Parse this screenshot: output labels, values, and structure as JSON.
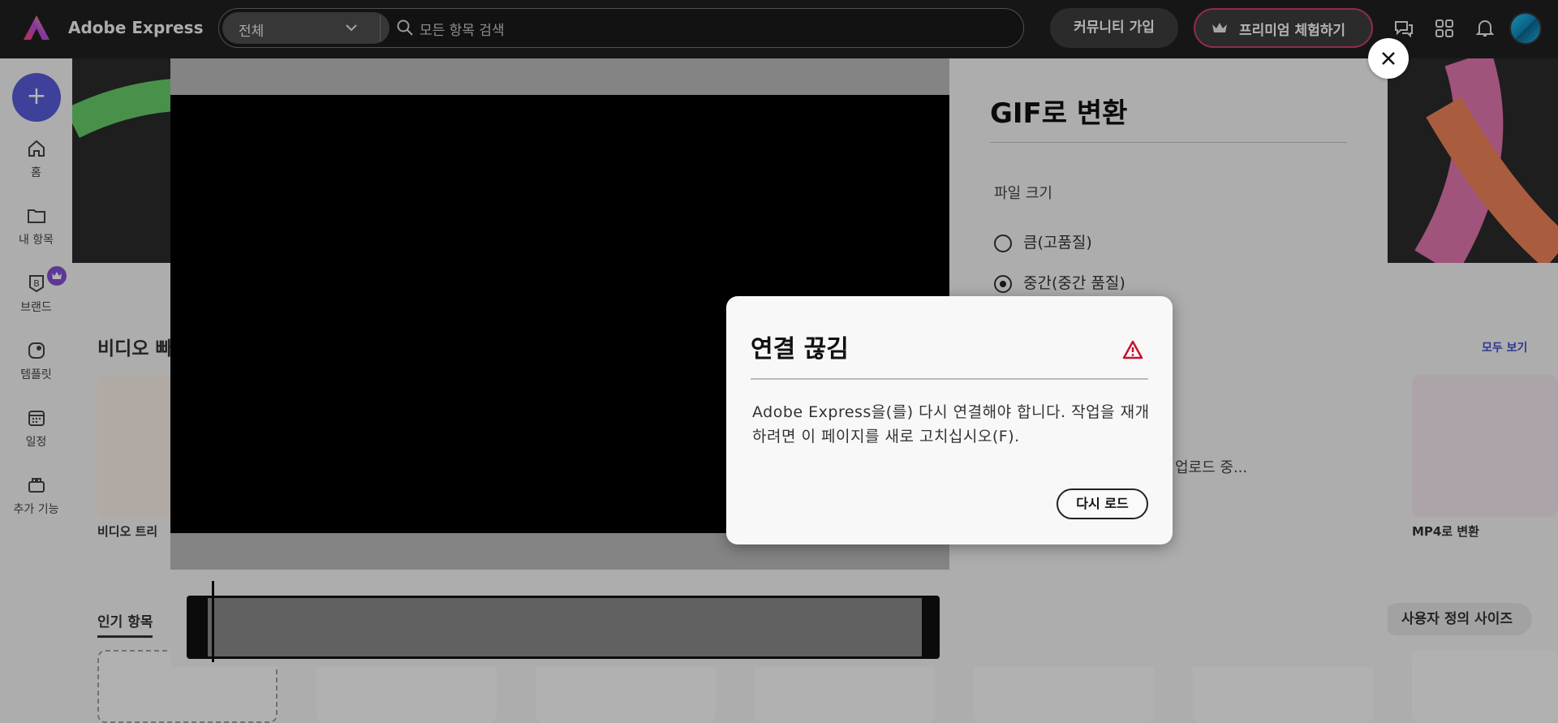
{
  "topbar": {
    "brand": "Adobe Express",
    "scope_selected": "전체",
    "search_placeholder": "모든 항목 검색",
    "community_label": "커뮤니티 가입",
    "premium_label": "프리미엄 체험하기",
    "icons": [
      "chat-icon",
      "apps-grid-icon",
      "bell-icon"
    ]
  },
  "rail": {
    "create_label": "+",
    "items": [
      {
        "label": "홈",
        "icon": "home-icon"
      },
      {
        "label": "내 항목",
        "icon": "folder-icon"
      },
      {
        "label": "브랜드",
        "icon": "brand-icon"
      },
      {
        "label": "템플릿",
        "icon": "template-icon"
      },
      {
        "label": "일정",
        "icon": "calendar-icon"
      },
      {
        "label": "추가 기능",
        "icon": "addons-icon"
      }
    ]
  },
  "background": {
    "section_title": "비디오 빠",
    "see_all": "모두 보기",
    "thumb_labels": [
      "비디오 트리",
      "MP4로 변환"
    ],
    "popular_tab": "인기 항목",
    "custom_size": "사용자 정의 사이즈"
  },
  "gif_panel": {
    "title": "GIF로 변환",
    "file_size_label": "파일 크기",
    "options": [
      {
        "label": "큼(고품질)",
        "checked": false
      },
      {
        "label": "중간(중간 품질)",
        "checked": true
      }
    ],
    "upload_status": "업로드 중..."
  },
  "alert": {
    "title": "연결 끊김",
    "body": "Adobe Express을(를) 다시 연결해야 합니다. 작업을 재개하려면 이 페이지를 새로 고치십시오(F).",
    "button": "다시 로드"
  },
  "colors": {
    "topbar": "#1e1e1e",
    "create_button": "#4b4fd6",
    "premium_border": "#c03a6a",
    "alert_icon": "#c8102e",
    "link": "#3440c6"
  }
}
